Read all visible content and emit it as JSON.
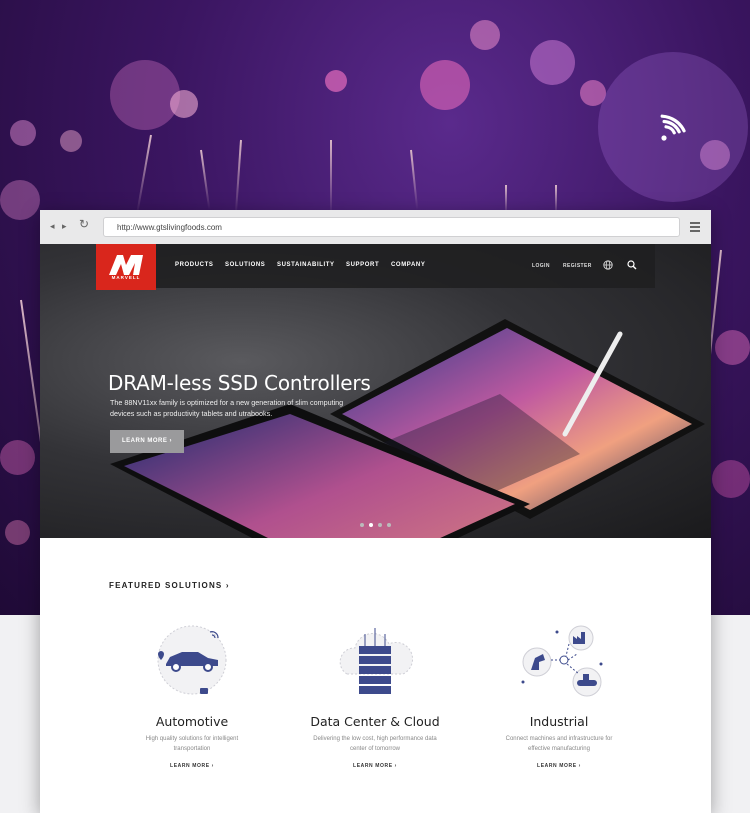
{
  "browser": {
    "url": "http://www.gtslivingfoods.com",
    "back": "◂",
    "forward": "▸",
    "reload": "↻"
  },
  "site": {
    "logo_text": "MARVELL",
    "nav": [
      "PRODUCTS",
      "SOLUTIONS",
      "SUSTAINABILITY",
      "SUPPORT",
      "COMPANY"
    ],
    "login": "LOGIN",
    "register": "REGISTER"
  },
  "hero": {
    "title": "DRAM-less SSD Controllers",
    "description": "The 88NV11xx family is optimized for a new generation of slim computing devices such as productivity tablets and utrabooks.",
    "button": "LEARN MORE",
    "button_arrow": "›",
    "slides_total": 4,
    "slide_active": 1
  },
  "featured": {
    "heading": "FEATURED SOLUTIONS",
    "arrow": "›",
    "cards": [
      {
        "title": "Automotive",
        "description": "High quality solutions for intelligent transportation",
        "link": "LEARN MORE",
        "arrow": "›"
      },
      {
        "title": "Data Center & Cloud",
        "description": "Delivering the low cost, high performance data center of tomorrow",
        "link": "LEARN MORE",
        "arrow": "›"
      },
      {
        "title": "Industrial",
        "description": "Connect machines and infrastructure for effective manufacturing",
        "link": "LEARN MORE",
        "arrow": "›"
      }
    ]
  },
  "colors": {
    "brand": "#d9261c",
    "accent": "#3d4a8c"
  },
  "icons": [
    "wifi-icon",
    "menu-icon",
    "globe-icon",
    "search-icon",
    "car-icon",
    "server-icon",
    "factory-icon"
  ]
}
